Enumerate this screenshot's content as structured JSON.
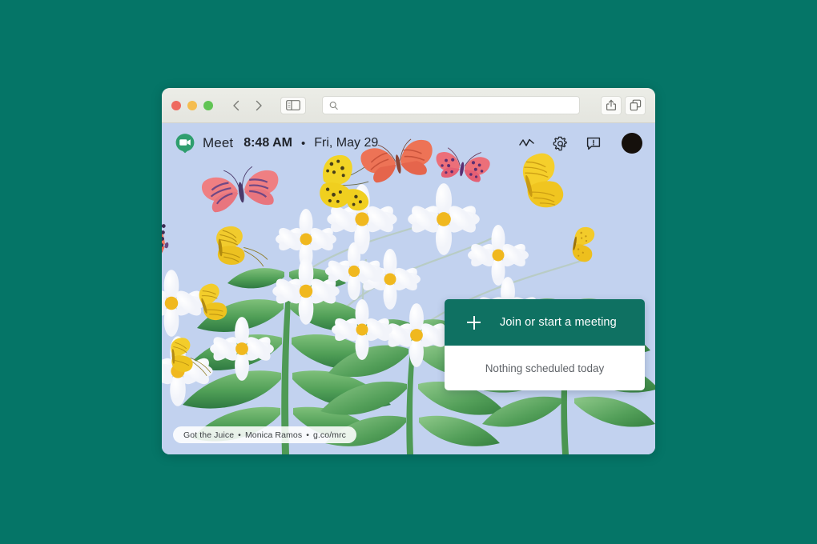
{
  "desktop": {
    "background_color": "#057567"
  },
  "browser": {
    "traffic_lights": {
      "close": "close",
      "minimize": "minimize",
      "zoom": "zoom"
    },
    "back_label": "Back",
    "forward_label": "Forward",
    "sidebar_label": "Show sidebar",
    "search": {
      "value": "",
      "placeholder": ""
    },
    "share_label": "Share",
    "tabs_overview_label": "Tab overview"
  },
  "meet_header": {
    "app_name": "Meet",
    "time": "8:48 AM",
    "separator": "•",
    "date": "Fri, May 29",
    "icons": [
      {
        "name": "activity-icon",
        "label": "Activity"
      },
      {
        "name": "gear-icon",
        "label": "Settings"
      },
      {
        "name": "feedback-icon",
        "label": "Send feedback"
      }
    ],
    "avatar_color": "#15100c"
  },
  "join_card": {
    "button_label": "Join or start a meeting",
    "button_color": "#0f7162",
    "plus_icon": "plus-icon",
    "schedule_text": "Nothing scheduled today"
  },
  "attribution": {
    "artwork_title": "Got the Juice",
    "artist": "Monica Ramos",
    "link": "g.co/mrc",
    "separator": "•"
  },
  "illustration": {
    "background_color": "#c2d2ef",
    "description": "Butterflies, daisies, green leaves and a caterpillar"
  }
}
